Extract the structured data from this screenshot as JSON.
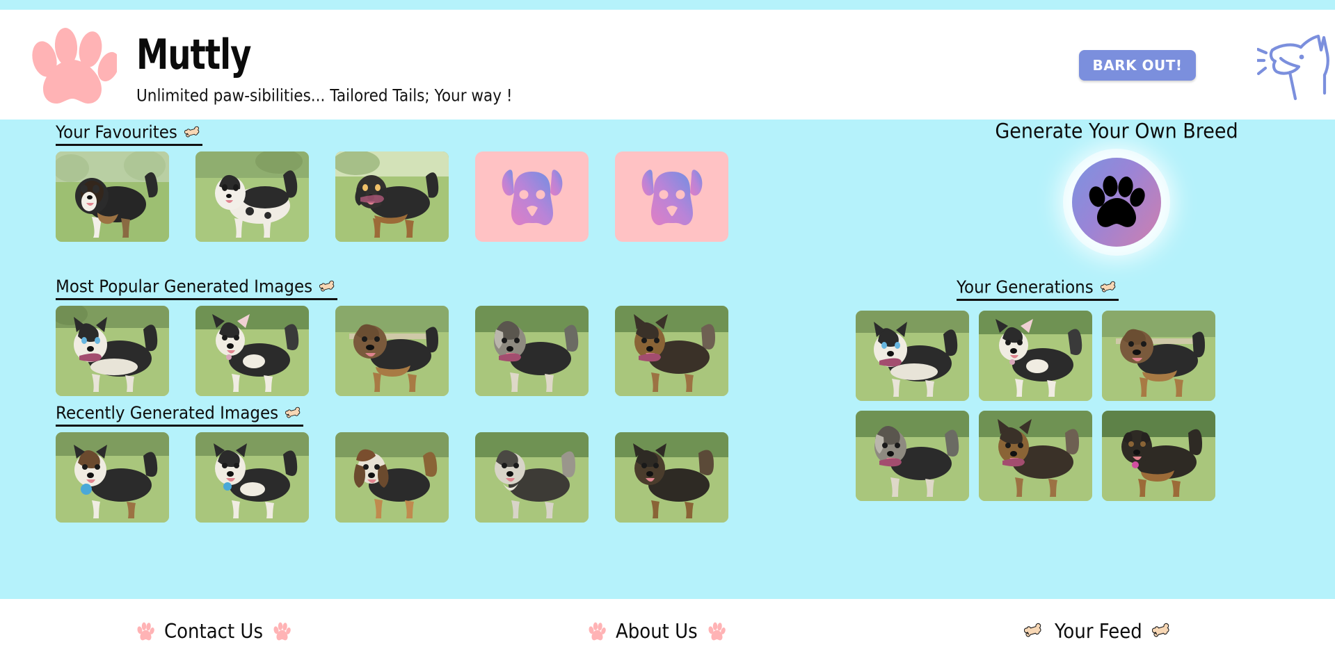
{
  "theme": {
    "background": "#b5f2fb",
    "panel": "#ffffff",
    "accent_pink": "#ffb3b5",
    "accent_blue": "#7b8fdd",
    "placeholder_bg": "#ffc2c4",
    "bone_fill": "#f7d7b5",
    "text": "#0d0d0d"
  },
  "header": {
    "logo_icon": "paw-print-icon",
    "title": "Muttly",
    "tagline": "Unlimited paw-sibilities... Tailored Tails; Your way !",
    "bark_button_label": "BARK OUT!",
    "bark_dog_icon": "barking-dog-icon"
  },
  "main": {
    "sections": [
      {
        "id": "favourites",
        "title": "Your Favourites",
        "icon": "bone-icon",
        "items": [
          {
            "type": "image",
            "alt": "tricolor bernese-mix dog standing on grass"
          },
          {
            "type": "image",
            "alt": "black and white spotted dog with fluffy tail"
          },
          {
            "type": "image",
            "alt": "black and tan dachshund-mix dog"
          },
          {
            "type": "placeholder",
            "alt": "dog face placeholder"
          },
          {
            "type": "placeholder",
            "alt": "dog face placeholder"
          }
        ]
      },
      {
        "id": "most-popular",
        "title": "Most Popular Generated Images",
        "icon": "bone-icon",
        "items": [
          {
            "type": "image",
            "alt": "husky-mix dog standing on lawn"
          },
          {
            "type": "image",
            "alt": "black and white corgi-mix puppy"
          },
          {
            "type": "image",
            "alt": "wrinkled shar-pei mix dog"
          },
          {
            "type": "image",
            "alt": "shaggy bearded collie-mix dog"
          },
          {
            "type": "image",
            "alt": "german shepherd-mix dog"
          }
        ]
      },
      {
        "id": "recently-generated",
        "title": "Recently Generated Images",
        "icon": "bone-icon",
        "items": [
          {
            "type": "image",
            "alt": "tricolor corgi-mix dog with blue tag"
          },
          {
            "type": "image",
            "alt": "black and white dog with blue collar tag"
          },
          {
            "type": "image",
            "alt": "basset hound-mix dog with long ears"
          },
          {
            "type": "image",
            "alt": "grey and white schnauzer-mix dog"
          },
          {
            "type": "image",
            "alt": "black and tan terrier-mix dog"
          }
        ]
      }
    ]
  },
  "generator": {
    "title": "Generate Your Own Breed",
    "orb_icon": "paw-print-icon",
    "generations": {
      "title": "Your Generations",
      "icon": "bone-icon",
      "items": [
        {
          "alt": "husky-mix dog standing on lawn"
        },
        {
          "alt": "black and white corgi-mix puppy"
        },
        {
          "alt": "wrinkled shar-pei mix dog"
        },
        {
          "alt": "shaggy bearded collie-mix dog"
        },
        {
          "alt": "german shepherd-mix dog"
        },
        {
          "alt": "rottweiler-mix dog"
        }
      ]
    }
  },
  "footer": {
    "items": [
      {
        "id": "contact",
        "label": "Contact Us",
        "left_icon": "paw-print-icon",
        "right_icon": "paw-print-icon"
      },
      {
        "id": "about",
        "label": "About Us",
        "left_icon": "paw-print-icon",
        "right_icon": "paw-print-icon"
      },
      {
        "id": "feed",
        "label": "Your Feed",
        "left_icon": "bone-icon",
        "right_icon": "bone-icon"
      }
    ]
  }
}
